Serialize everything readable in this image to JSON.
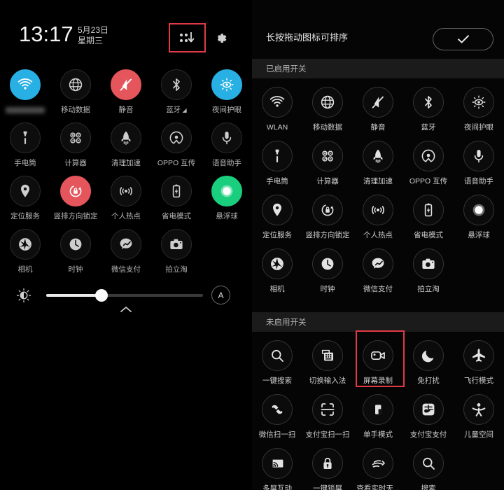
{
  "left_panel": {
    "status": {
      "time": "13:17",
      "date": "5月23日",
      "weekday": "星期三",
      "edit_icon": "grid-reorder-icon",
      "settings_icon": "gear-icon"
    },
    "tiles": [
      {
        "label": "",
        "label_masked": true,
        "icon": "wifi-icon",
        "state": "on",
        "color": "#28b0e4"
      },
      {
        "label": "移动数据",
        "icon": "globe-icon",
        "state": "off"
      },
      {
        "label": "静音",
        "icon": "mute-icon",
        "state": "on",
        "color": "#e5555c"
      },
      {
        "label": "蓝牙",
        "icon": "bluetooth-icon",
        "state": "off"
      },
      {
        "label": "夜间护眼",
        "icon": "night-eye-icon",
        "state": "on",
        "color": "#28b0e4"
      },
      {
        "label": "手电筒",
        "icon": "flashlight-icon",
        "state": "off"
      },
      {
        "label": "计算器",
        "icon": "calculator-icon",
        "state": "off"
      },
      {
        "label": "清理加速",
        "icon": "rocket-icon",
        "state": "off"
      },
      {
        "label": "OPPO 互传",
        "icon": "oppo-share-icon",
        "state": "off"
      },
      {
        "label": "语音助手",
        "icon": "microphone-icon",
        "state": "off"
      },
      {
        "label": "定位服务",
        "icon": "location-pin-icon",
        "state": "off"
      },
      {
        "label": "竖排方向锁定",
        "icon": "rotation-lock-icon",
        "state": "on",
        "color": "#e5555c"
      },
      {
        "label": "个人热点",
        "icon": "hotspot-icon",
        "state": "off"
      },
      {
        "label": "省电模式",
        "icon": "battery-saver-icon",
        "state": "off"
      },
      {
        "label": "悬浮球",
        "icon": "floating-ball-icon",
        "state": "on",
        "color": "#19ce7c"
      },
      {
        "label": "相机",
        "icon": "camera-shutter-icon",
        "state": "off"
      },
      {
        "label": "时钟",
        "icon": "clock-icon",
        "state": "off"
      },
      {
        "label": "微信支付",
        "icon": "wechat-pay-icon",
        "state": "off"
      },
      {
        "label": "拍立淘",
        "icon": "camera-icon",
        "state": "off"
      }
    ],
    "brightness": {
      "icon": "brightness-icon",
      "value_percent": 34,
      "auto_label": "A",
      "expand_icon": "chevron-up-icon"
    }
  },
  "right_panel": {
    "header": {
      "hint": "长按拖动图标可排序",
      "done_icon": "check-icon"
    },
    "sections": [
      {
        "title": "已启用开关",
        "tiles": [
          {
            "label": "WLAN",
            "icon": "wifi-icon"
          },
          {
            "label": "移动数据",
            "icon": "globe-icon"
          },
          {
            "label": "静音",
            "icon": "mute-icon"
          },
          {
            "label": "蓝牙",
            "icon": "bluetooth-icon"
          },
          {
            "label": "夜间护眼",
            "icon": "night-eye-icon"
          },
          {
            "label": "手电筒",
            "icon": "flashlight-icon"
          },
          {
            "label": "计算器",
            "icon": "calculator-icon"
          },
          {
            "label": "清理加速",
            "icon": "rocket-icon"
          },
          {
            "label": "OPPO 互传",
            "icon": "oppo-share-icon"
          },
          {
            "label": "语音助手",
            "icon": "microphone-icon"
          },
          {
            "label": "定位服务",
            "icon": "location-pin-icon"
          },
          {
            "label": "竖排方向锁定",
            "icon": "rotation-lock-icon"
          },
          {
            "label": "个人热点",
            "icon": "hotspot-icon"
          },
          {
            "label": "省电模式",
            "icon": "battery-saver-icon"
          },
          {
            "label": "悬浮球",
            "icon": "floating-ball-icon"
          },
          {
            "label": "相机",
            "icon": "camera-shutter-icon"
          },
          {
            "label": "时钟",
            "icon": "clock-icon"
          },
          {
            "label": "微信支付",
            "icon": "wechat-pay-icon"
          },
          {
            "label": "拍立淘",
            "icon": "camera-icon"
          }
        ]
      },
      {
        "title": "未启用开关",
        "tiles": [
          {
            "label": "一键搜索",
            "icon": "search-icon"
          },
          {
            "label": "切换输入法",
            "icon": "keyboard-icon"
          },
          {
            "label": "屏幕录制",
            "icon": "screen-record-icon",
            "highlighted": true
          },
          {
            "label": "免打扰",
            "icon": "moon-icon"
          },
          {
            "label": "飞行模式",
            "icon": "airplane-icon"
          },
          {
            "label": "微信扫一扫",
            "icon": "wechat-scan-icon"
          },
          {
            "label": "支付宝扫一扫",
            "icon": "scan-frame-icon"
          },
          {
            "label": "单手模式",
            "icon": "one-hand-icon"
          },
          {
            "label": "支付宝支付",
            "icon": "alipay-icon"
          },
          {
            "label": "儿童空间",
            "icon": "kids-space-icon"
          },
          {
            "label": "多屏互动",
            "icon": "screen-cast-icon"
          },
          {
            "label": "一键锁屏",
            "icon": "lock-icon"
          },
          {
            "label": "查看实时天...",
            "icon": "weather-hand-icon"
          },
          {
            "label": "搜索",
            "icon": "search-icon"
          }
        ]
      }
    ]
  },
  "highlights": {
    "accent_color": "#e03a47",
    "boxes": [
      {
        "target": "grid-reorder-icon",
        "panel": "left"
      },
      {
        "target": "屏幕录制",
        "panel": "right"
      }
    ]
  }
}
